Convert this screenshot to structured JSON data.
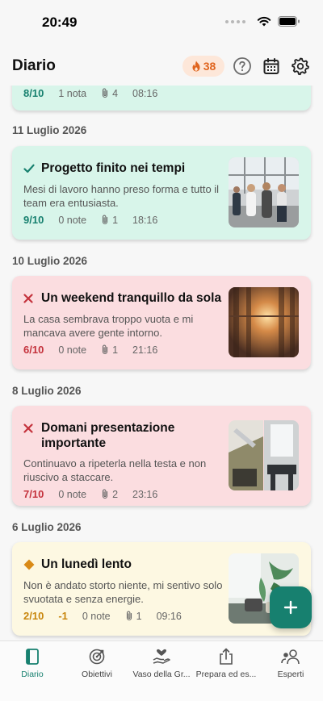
{
  "status_bar": {
    "time": "20:49"
  },
  "header": {
    "title": "Diario",
    "streak_count": "38"
  },
  "entries_top": {
    "score": "8/10",
    "notes": "1 nota",
    "attachments": "4",
    "time": "08:16"
  },
  "entries": [
    {
      "date": "11 Luglio 2026",
      "title": "Progetto finito nei tempi",
      "body": "Mesi di lavoro hanno preso forma e tutto il team era entusiasta.",
      "score": "9/10",
      "notes": "0 note",
      "attachments": "1",
      "time": "18:16",
      "mood": "check-icon",
      "color": "#17806f"
    },
    {
      "date": "10 Luglio 2026",
      "title": "Un weekend tranquillo da sola",
      "body": "La casa sembrava troppo vuota e mi mancava avere gente intorno.",
      "score": "6/10",
      "notes": "0 note",
      "attachments": "1",
      "time": "21:16",
      "mood": "cross-icon",
      "color": "#c4323c"
    },
    {
      "date": "8 Luglio 2026",
      "title": "Domani presentazione importante",
      "body": "Continuavo a ripeterla nella testa e non riuscivo a staccare.",
      "score": "7/10",
      "notes": "0 note",
      "attachments": "2",
      "time": "23:16",
      "mood": "cross-icon",
      "color": "#c4323c"
    },
    {
      "date": "6 Luglio 2026",
      "title": "Un lunedì lento",
      "body": "Non è andato storto niente, mi sentivo solo svuotata e senza energie.",
      "score": "2/10",
      "delta": "-1",
      "notes": "0 note",
      "attachments": "1",
      "time": "09:16",
      "mood": "diamond-icon",
      "color": "#d98a16"
    }
  ],
  "tabs": [
    {
      "label": "Diario",
      "icon": "book-icon",
      "active": true
    },
    {
      "label": "Obiettivi",
      "icon": "target-icon"
    },
    {
      "label": "Vaso della Gr...",
      "icon": "heart-hand-icon"
    },
    {
      "label": "Prepara ed es...",
      "icon": "share-icon"
    },
    {
      "label": "Esperti",
      "icon": "people-icon"
    }
  ],
  "colors": {
    "accent": "#17806f",
    "streak": "#e0651f"
  }
}
